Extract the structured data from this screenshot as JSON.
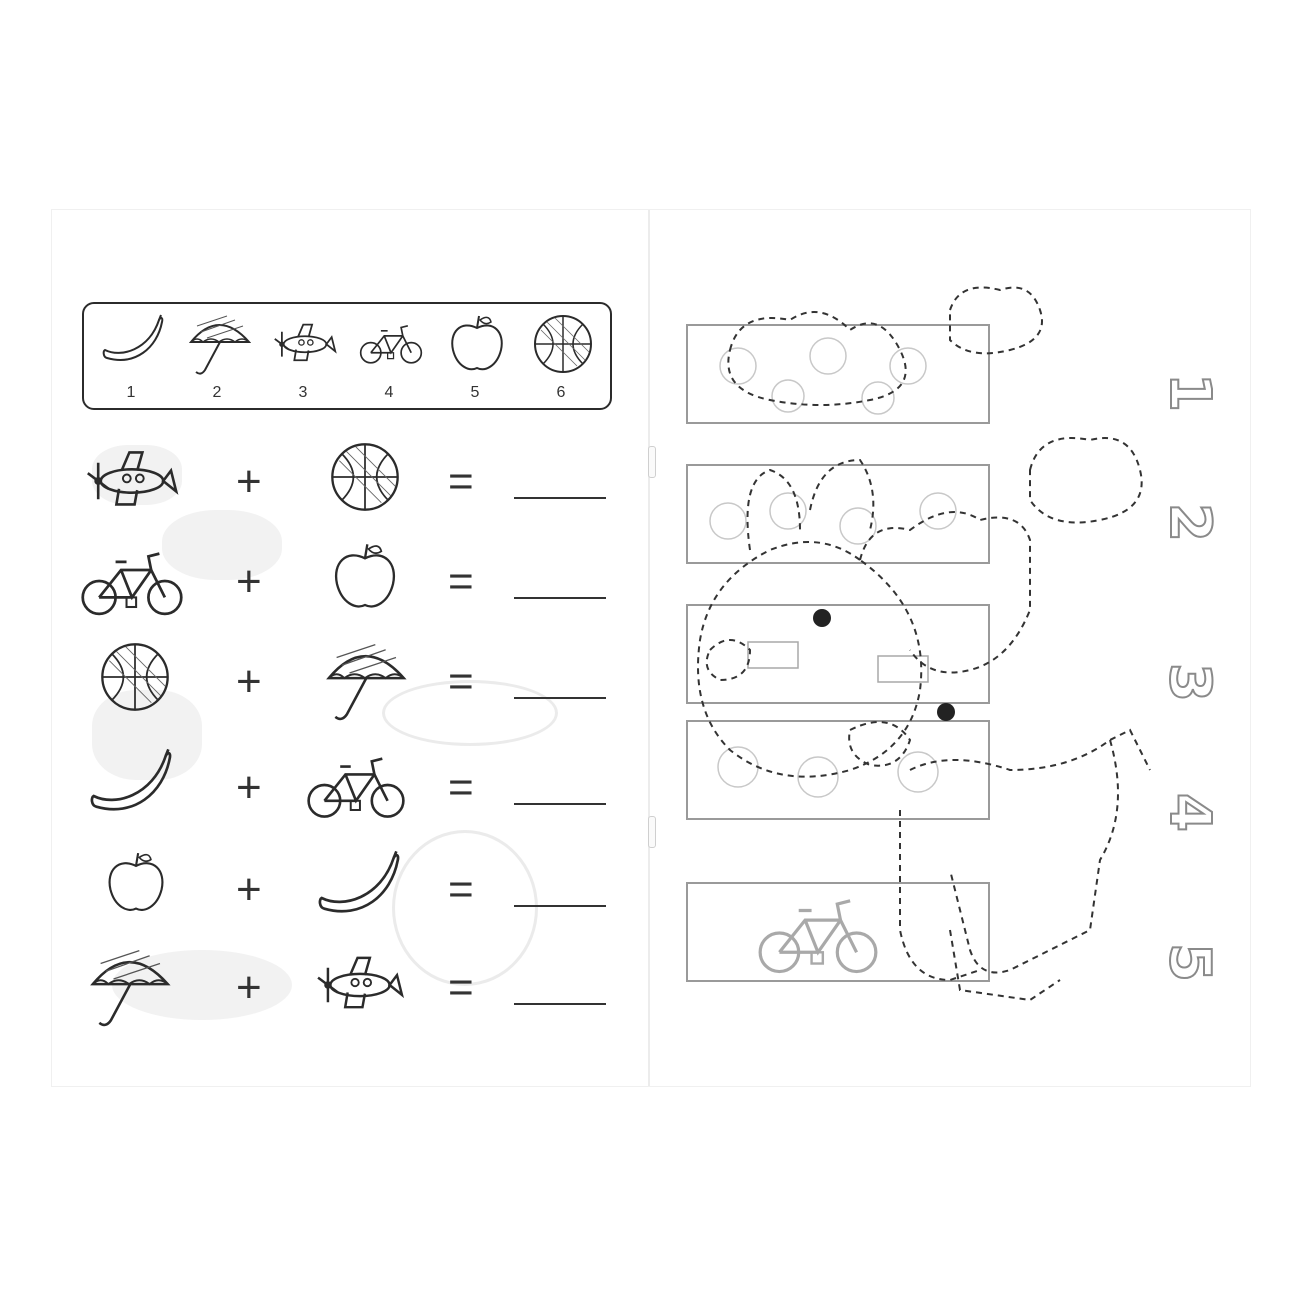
{
  "legend": {
    "items": [
      {
        "num": "1",
        "icon": "banana-icon"
      },
      {
        "num": "2",
        "icon": "umbrella-icon"
      },
      {
        "num": "3",
        "icon": "airplane-icon"
      },
      {
        "num": "4",
        "icon": "bicycle-icon"
      },
      {
        "num": "5",
        "icon": "apple-icon"
      },
      {
        "num": "6",
        "icon": "ball-icon"
      }
    ]
  },
  "equations": [
    {
      "a": "airplane-icon",
      "b": "ball-icon",
      "plus": "+",
      "equals": "="
    },
    {
      "a": "bicycle-icon",
      "b": "apple-icon",
      "plus": "+",
      "equals": "="
    },
    {
      "a": "ball-icon",
      "b": "umbrella-icon",
      "plus": "+",
      "equals": "="
    },
    {
      "a": "banana-icon",
      "b": "bicycle-icon",
      "plus": "+",
      "equals": "="
    },
    {
      "a": "apple-icon",
      "b": "banana-icon",
      "plus": "+",
      "equals": "="
    },
    {
      "a": "umbrella-icon",
      "b": "airplane-icon",
      "plus": "+",
      "equals": "="
    }
  ],
  "right_page": {
    "counting_boxes": [
      "ladybugs-box",
      "apples-box",
      "cakes-box",
      "puppies-box",
      "bicycle-box"
    ],
    "numbers": [
      "1",
      "2",
      "3",
      "4",
      "5"
    ],
    "tracing": "dashed-cow-outline"
  }
}
